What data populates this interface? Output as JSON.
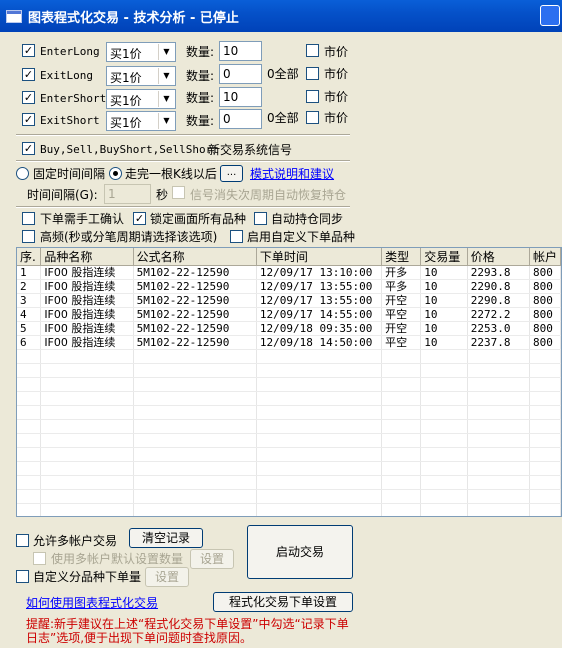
{
  "window": {
    "title": "图表程式化交易 - 技术分析 - 已停止"
  },
  "signals": [
    {
      "name": "EnterLong",
      "checked": true,
      "price_type": "买1价",
      "qty_label": "数量:",
      "qty": "10",
      "all_label": "",
      "market_label": "市价"
    },
    {
      "name": "ExitLong",
      "checked": true,
      "price_type": "买1价",
      "qty_label": "数量:",
      "qty": "0",
      "all_label": "0全部",
      "market_label": "市价"
    },
    {
      "name": "EnterShort",
      "checked": true,
      "price_type": "买1价",
      "qty_label": "数量:",
      "qty": "10",
      "all_label": "",
      "market_label": "市价"
    },
    {
      "name": "ExitShort",
      "checked": true,
      "price_type": "买1价",
      "qty_label": "数量:",
      "qty": "0",
      "all_label": "0全部",
      "market_label": "市价"
    }
  ],
  "new_signal": {
    "label_mono": "Buy,Sell,BuyShort,SellShort",
    "label_cn": "新交易系统信号",
    "checked": true
  },
  "timing": {
    "fixed_interval": "固定时间间隔",
    "after_bar": "走完一根K线以后",
    "ellipsis": "...",
    "mode_link": "模式说明和建议",
    "interval_label": "时间间隔(G):",
    "interval_value": "1",
    "seconds": "秒",
    "restore_label": "信号消失次周期自动恢复持仓"
  },
  "options": {
    "manual_confirm": "下单需手工确认",
    "lock_all": "锁定画面所有品种",
    "auto_sync": "自动持仓同步",
    "high_freq": "高频(秒或分笔周期请选择该选项)",
    "custom_varieties": "启用自定义下单品种"
  },
  "table": {
    "headers": [
      "序.",
      "品种名称",
      "公式名称",
      "下单时间",
      "类型",
      "交易量",
      "价格",
      "帐户"
    ],
    "rows": [
      [
        "1",
        "IF00 股指连续",
        "5M102-22-12590",
        "12/09/17 13:10:00",
        "开多",
        "10",
        "2293.8",
        "800"
      ],
      [
        "2",
        "IF00 股指连续",
        "5M102-22-12590",
        "12/09/17 13:55:00",
        "平多",
        "10",
        "2290.8",
        "800"
      ],
      [
        "3",
        "IF00 股指连续",
        "5M102-22-12590",
        "12/09/17 13:55:00",
        "开空",
        "10",
        "2290.8",
        "800"
      ],
      [
        "4",
        "IF00 股指连续",
        "5M102-22-12590",
        "12/09/17 14:55:00",
        "平空",
        "10",
        "2272.2",
        "800"
      ],
      [
        "5",
        "IF00 股指连续",
        "5M102-22-12590",
        "12/09/18 09:35:00",
        "开空",
        "10",
        "2253.0",
        "800"
      ],
      [
        "6",
        "IF00 股指连续",
        "5M102-22-12590",
        "12/09/18 14:50:00",
        "平空",
        "10",
        "2237.8",
        "800"
      ]
    ]
  },
  "bottom": {
    "multi_account": "允许多帐户交易",
    "clear_records": "清空记录",
    "default_qty": "使用多帐户默认设置数量",
    "settings1": "设置",
    "custom_qty": "自定义分品种下单量",
    "settings2": "设置",
    "start": "启动交易",
    "howto_link": "如何使用图表程式化交易",
    "order_settings": "程式化交易下单设置",
    "tip": "提醒:新手建议在上述“程式化交易下单设置”中勾选“记录下单日志”选项,便于出现下单问题时查找原因。"
  }
}
